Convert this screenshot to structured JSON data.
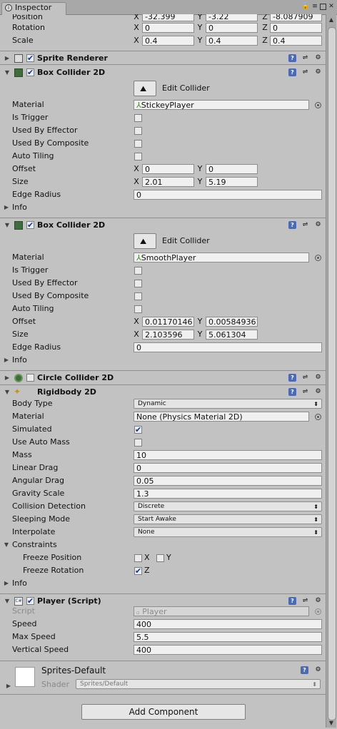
{
  "window": {
    "tab_label": "Inspector",
    "lock_icon": "lock-icon",
    "menu_icon": "menu-icon",
    "maximize_icon": "maximize-icon",
    "close_icon": "close-icon"
  },
  "transform": {
    "position": {
      "label": "Position",
      "x": "-32.399",
      "y": "-3.22",
      "z": "-8.087909"
    },
    "rotation": {
      "label": "Rotation",
      "x": "0",
      "y": "0",
      "z": "0"
    },
    "scale": {
      "label": "Scale",
      "x": "0.4",
      "y": "0.4",
      "z": "0.4"
    }
  },
  "axis": {
    "x": "X",
    "y": "Y",
    "z": "Z"
  },
  "sprite_renderer": {
    "title": "Sprite Renderer",
    "enabled": true,
    "collapsed": true
  },
  "box1": {
    "title": "Box Collider 2D",
    "enabled": true,
    "edit_collider": "Edit Collider",
    "material_label": "Material",
    "material_value": "StickeyPlayer",
    "is_trigger": "Is Trigger",
    "used_by_effector": "Used By Effector",
    "used_by_composite": "Used By Composite",
    "auto_tiling": "Auto Tiling",
    "offset_label": "Offset",
    "offset_x": "0",
    "offset_y": "0",
    "size_label": "Size",
    "size_x": "2.01",
    "size_y": "5.19",
    "edge_radius_label": "Edge Radius",
    "edge_radius": "0",
    "info": "Info"
  },
  "box2": {
    "title": "Box Collider 2D",
    "enabled": true,
    "edit_collider": "Edit Collider",
    "material_label": "Material",
    "material_value": "SmoothPlayer",
    "is_trigger": "Is Trigger",
    "used_by_effector": "Used By Effector",
    "used_by_composite": "Used By Composite",
    "auto_tiling": "Auto Tiling",
    "offset_label": "Offset",
    "offset_x": "0.01170146",
    "offset_y": "0.005849361",
    "size_label": "Size",
    "size_x": "2.103596",
    "size_y": "5.061304",
    "edge_radius_label": "Edge Radius",
    "edge_radius": "0",
    "info": "Info"
  },
  "circle_collider": {
    "title": "Circle Collider 2D",
    "enabled": false,
    "collapsed": true
  },
  "rigidbody": {
    "title": "Rigidbody 2D",
    "body_type_label": "Body Type",
    "body_type": "Dynamic",
    "material_label": "Material",
    "material_value": "None (Physics Material 2D)",
    "simulated_label": "Simulated",
    "simulated": true,
    "use_auto_mass_label": "Use Auto Mass",
    "use_auto_mass": false,
    "mass_label": "Mass",
    "mass": "10",
    "linear_drag_label": "Linear Drag",
    "linear_drag": "0",
    "angular_drag_label": "Angular Drag",
    "angular_drag": "0.05",
    "gravity_scale_label": "Gravity Scale",
    "gravity_scale": "1.3",
    "collision_detection_label": "Collision Detection",
    "collision_detection": "Discrete",
    "sleeping_mode_label": "Sleeping Mode",
    "sleeping_mode": "Start Awake",
    "interpolate_label": "Interpolate",
    "interpolate": "None",
    "constraints_label": "Constraints",
    "freeze_position_label": "Freeze Position",
    "freeze_rotation_label": "Freeze Rotation",
    "info": "Info"
  },
  "player_script": {
    "title": "Player (Script)",
    "enabled": true,
    "script_label": "Script",
    "script_value": "Player",
    "speed_label": "Speed",
    "speed": "400",
    "max_speed_label": "Max Speed",
    "max_speed": "5.5",
    "vertical_speed_label": "Vertical Speed",
    "vertical_speed": "400"
  },
  "material": {
    "name": "Sprites-Default",
    "shader_label": "Shader",
    "shader_value": "Sprites/Default"
  },
  "add_component": "Add Component"
}
